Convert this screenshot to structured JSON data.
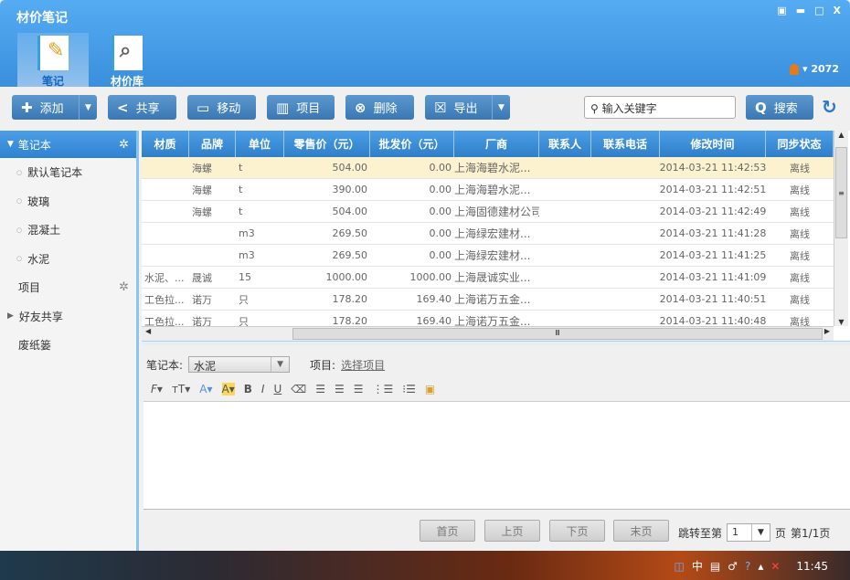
{
  "app": {
    "title": "材价笔记",
    "user": "2072"
  },
  "nav": [
    {
      "label": "笔记"
    },
    {
      "label": "材价库"
    }
  ],
  "toolbar": {
    "add": "添加",
    "share": "共享",
    "move": "移动",
    "project": "项目",
    "delete": "删除",
    "export": "导出",
    "search_placeholder": "输入关键字",
    "search": "搜索"
  },
  "sidebar": {
    "notebook": "笔记本",
    "items": [
      "默认笔记本",
      "玻璃",
      "混凝土",
      "水泥"
    ],
    "project": "项目",
    "friends": "好友共享",
    "trash": "废纸篓"
  },
  "table": {
    "columns": [
      "材质",
      "品牌",
      "单位",
      "零售价（元）",
      "批发价（元）",
      "厂商",
      "联系人",
      "联系电话",
      "修改时间",
      "同步状态"
    ],
    "rows": [
      [
        "",
        "海螺",
        "t",
        "504.00",
        "0.00",
        "上海海碧水泥...",
        "",
        "",
        "2014-03-21 11:42:53",
        "离线"
      ],
      [
        "",
        "海螺",
        "t",
        "390.00",
        "0.00",
        "上海海碧水泥...",
        "",
        "",
        "2014-03-21 11:42:51",
        "离线"
      ],
      [
        "",
        "海螺",
        "t",
        "504.00",
        "0.00",
        "上海固德建材公司",
        "",
        "",
        "2014-03-21 11:42:49",
        "离线"
      ],
      [
        "",
        "",
        "m3",
        "269.50",
        "0.00",
        "上海绿宏建材...",
        "",
        "",
        "2014-03-21 11:41:28",
        "离线"
      ],
      [
        "",
        "",
        "m3",
        "269.50",
        "0.00",
        "上海绿宏建材...",
        "",
        "",
        "2014-03-21 11:41:25",
        "离线"
      ],
      [
        "水泥、...",
        "晟诚",
        "15",
        "1000.00",
        "1000.00",
        "上海晟诚实业...",
        "",
        "",
        "2014-03-21 11:41:09",
        "离线"
      ],
      [
        "工色拉...",
        "诺万",
        "只",
        "178.20",
        "169.40",
        "上海诺万五金...",
        "",
        "",
        "2014-03-21 11:40:51",
        "离线"
      ],
      [
        "工色拉...",
        "诺万",
        "只",
        "178.20",
        "169.40",
        "上海诺万五金...",
        "",
        "",
        "2014-03-21 11:40:48",
        "离线"
      ]
    ]
  },
  "detail": {
    "notebook_label": "笔记本:",
    "notebook_value": "水泥",
    "project_label": "项目:",
    "project_link": "选择项目"
  },
  "pager": {
    "first": "首页",
    "prev": "上页",
    "next": "下页",
    "last": "末页",
    "jump": "跳转至第",
    "page": "1",
    "unit": "页",
    "info": "第1/1页"
  },
  "taskbar": {
    "time": "11:45",
    "ime": "中"
  }
}
